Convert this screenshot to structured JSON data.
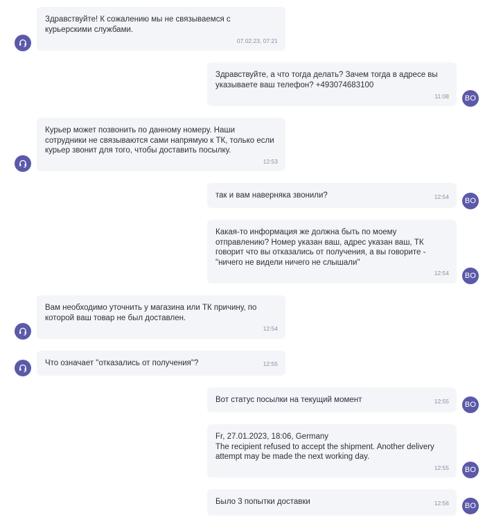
{
  "user_initials": "BO",
  "icons": {
    "agent": "headset-icon"
  },
  "colors": {
    "avatar": "#5b59a8",
    "bubble": "#f4f5f8",
    "timestamp": "#8a8f9c"
  },
  "messages": [
    {
      "sender": "agent",
      "text": "Здравствуйте! К сожалению мы не связываемся с курьерскими службами.",
      "time": "07.02.23, 07:21"
    },
    {
      "sender": "user",
      "text": "Здравствуйте, а что тогда делать? Зачем тогда в адресе вы указываете ваш телефон? +493074683100",
      "time": "11:08"
    },
    {
      "sender": "agent",
      "text": "Курьер может позвонить по данному номеру. Наши сотрудники не связываются сами напрямую к ТК, только если курьер звонит для того, чтобы доставить посылку.",
      "time": "12:53"
    },
    {
      "sender": "user",
      "text": "так и вам наверняка звонили?",
      "time": "12:54"
    },
    {
      "sender": "user",
      "text": "Какая-то информация же должна быть по моему отправлению? Номер указан ваш, адрес указан ваш, ТК говорит что вы отказались от получения, а вы говорите - \"ничего не видели ничего не слышали\"",
      "time": "12:54"
    },
    {
      "sender": "agent",
      "text": "Вам необходимо уточнить у магазина или ТК причину, по которой ваш товар не был доставлен.",
      "time": "12:54"
    },
    {
      "sender": "agent",
      "text": "Что означает \"отказались от получения\"?",
      "time": "12:55"
    },
    {
      "sender": "user",
      "text": "Вот статус посылки на текущий момент",
      "time": "12:55"
    },
    {
      "sender": "user",
      "text": "Fr, 27.01.2023, 18:06, Germany\nThe recipient refused to accept the shipment. Another delivery attempt may be made the next working day.",
      "time": "12:55"
    },
    {
      "sender": "user",
      "text": "Было 3 попытки доставки",
      "time": "12:56"
    }
  ]
}
